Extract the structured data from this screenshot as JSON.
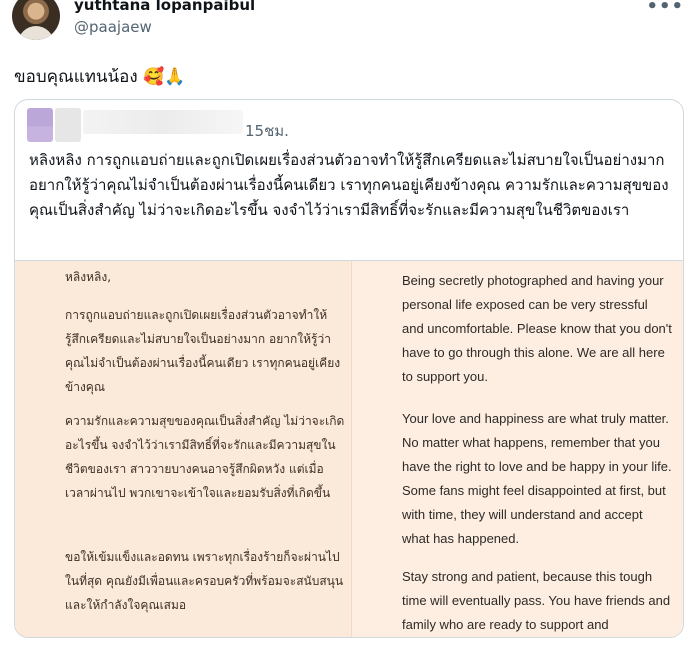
{
  "post": {
    "display_name": "yuthtana lopanpaibul",
    "handle": "@paajaew",
    "text": "ขอบคุณแทนน้อง",
    "emojis": "🥰🙏",
    "more_icon": "more-icon"
  },
  "quote": {
    "time": "15ชม.",
    "text": "หลิงหลิง การถูกแอบถ่ายและถูกเปิดเผยเรื่องส่วนตัวอาจทำให้รู้สึกเครียดและไม่สบายใจเป็นอย่างมาก อยากให้รู้ว่าคุณไม่จำเป็นต้องผ่านเรื่องนี้คนเดียว เราทุกคนอยู่เคียงข้างคุณ ความรักและความสุขของคุณเป็นสิ่งสำคัญ ไม่ว่าจะเกิดอะไรขึ้น จงจำไว้ว่าเรามีสิทธิ์ที่จะรักและมีความสุขในชีวิตของเรา",
    "image": {
      "thai": {
        "greeting": "หลิงหลิง,",
        "p1": "การถูกแอบถ่ายและถูกเปิดเผยเรื่องส่วนตัวอาจทำให้รู้สึกเครียดและไม่สบายใจเป็นอย่างมาก อยากให้รู้ว่าคุณไม่จำเป็นต้องผ่านเรื่องนี้คนเดียว เราทุกคนอยู่เคียงข้างคุณ",
        "p2": "ความรักและความสุขของคุณเป็นสิ่งสำคัญ ไม่ว่าจะเกิดอะไรขึ้น จงจำไว้ว่าเรามีสิทธิ์ที่จะรักและมีความสุขในชีวิตของเรา สาววายบางคนอาจรู้สึกผิดหวัง แต่เมื่อเวลาผ่านไป พวกเขาจะเข้าใจและยอมรับสิ่งที่เกิดขึ้น",
        "p3": "ขอให้เข้มแข็งและอดทน เพราะทุกเรื่องร้ายก็จะผ่านไปในที่สุด คุณยังมีเพื่อนและครอบครัวที่พร้อมจะสนับสนุนและให้กำลังใจคุณเสมอ"
      },
      "english": {
        "p1": "Being secretly photographed and having your personal life exposed can be very stressful and uncomfortable. Please know that you don't have to go through this alone. We are all here to support you.",
        "p2": "Your love and happiness are what truly matter. No matter what happens, remember that you have the right to love and be happy in your life. Some fans might feel disappointed at first, but with time, they will understand and accept what has happened.",
        "p3": "Stay strong and patient, because this tough time will eventually pass. You have friends and family who are ready to support and"
      }
    }
  }
}
